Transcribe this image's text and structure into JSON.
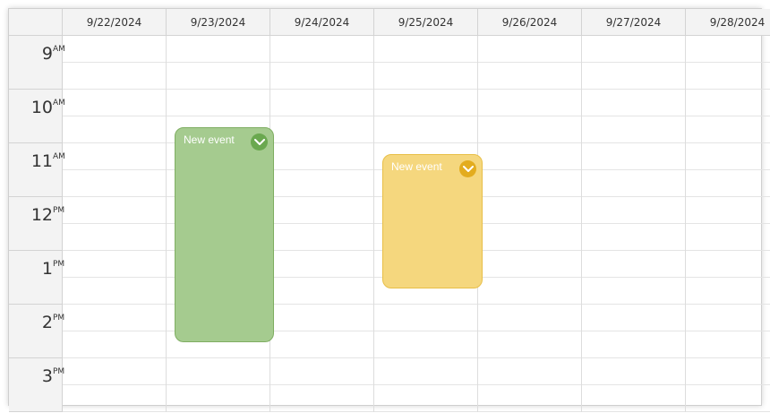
{
  "columns": [
    {
      "label": "9/22/2024"
    },
    {
      "label": "9/23/2024"
    },
    {
      "label": "9/24/2024"
    },
    {
      "label": "9/25/2024"
    },
    {
      "label": "9/26/2024"
    },
    {
      "label": "9/27/2024"
    },
    {
      "label": "9/28/2024"
    }
  ],
  "hours": [
    {
      "num": "9",
      "ampm": "AM"
    },
    {
      "num": "10",
      "ampm": "AM"
    },
    {
      "num": "11",
      "ampm": "AM"
    },
    {
      "num": "12",
      "ampm": "PM"
    },
    {
      "num": "1",
      "ampm": "PM"
    },
    {
      "num": "2",
      "ampm": "PM"
    },
    {
      "num": "3",
      "ampm": "PM"
    }
  ],
  "events": [
    {
      "label": "New event",
      "day": "9/23/2024",
      "start": "10:30 AM",
      "end": "2:30 PM",
      "color": "#a5cb8f",
      "border": "#7fae62",
      "button_color": "#6aa84f",
      "icon": "chevron-down-icon"
    },
    {
      "label": "New event",
      "day": "9/25/2024",
      "start": "11:00 AM",
      "end": "1:30 PM",
      "color": "#f5d77e",
      "border": "#e8bf48",
      "button_color": "#e3ac1e",
      "icon": "chevron-down-icon"
    }
  ]
}
